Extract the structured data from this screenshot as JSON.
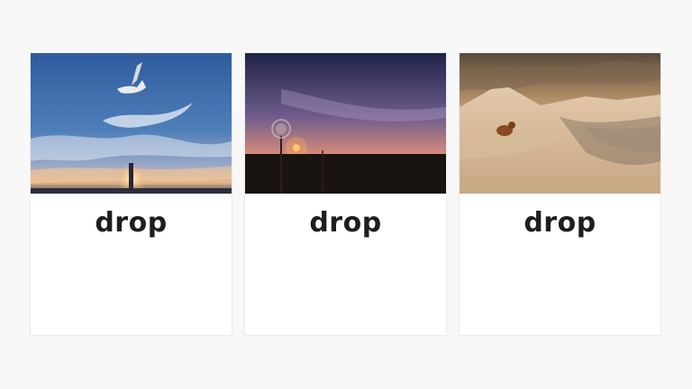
{
  "cards": [
    {
      "image": "seagull-sunset-sky-photo",
      "caption": "drop"
    },
    {
      "image": "dandelion-sunset-photo",
      "caption": "drop"
    },
    {
      "image": "sand-dunes-dog-photo",
      "caption": "drop"
    }
  ]
}
